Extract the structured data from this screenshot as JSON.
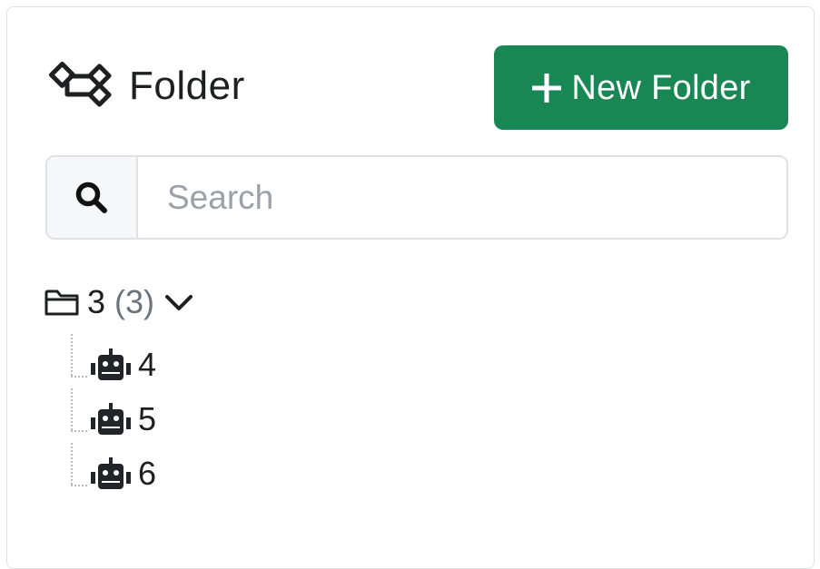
{
  "header": {
    "title": "Folder",
    "title_icon": "tree-structure-icon",
    "new_folder_label": "New Folder",
    "new_folder_icon": "plus-icon"
  },
  "search": {
    "icon": "search-icon",
    "placeholder": "Search",
    "value": ""
  },
  "tree": {
    "root": {
      "icon": "folder-icon",
      "name": "3",
      "count": "(3)",
      "toggle_icon": "chevron-down-icon"
    },
    "children": [
      {
        "icon": "robot-icon",
        "label": "4"
      },
      {
        "icon": "robot-icon",
        "label": "5"
      },
      {
        "icon": "robot-icon",
        "label": "6"
      }
    ]
  },
  "colors": {
    "accent": "#198754",
    "text": "#1e1f21",
    "muted": "#6c757d",
    "border": "#dee2e6"
  }
}
